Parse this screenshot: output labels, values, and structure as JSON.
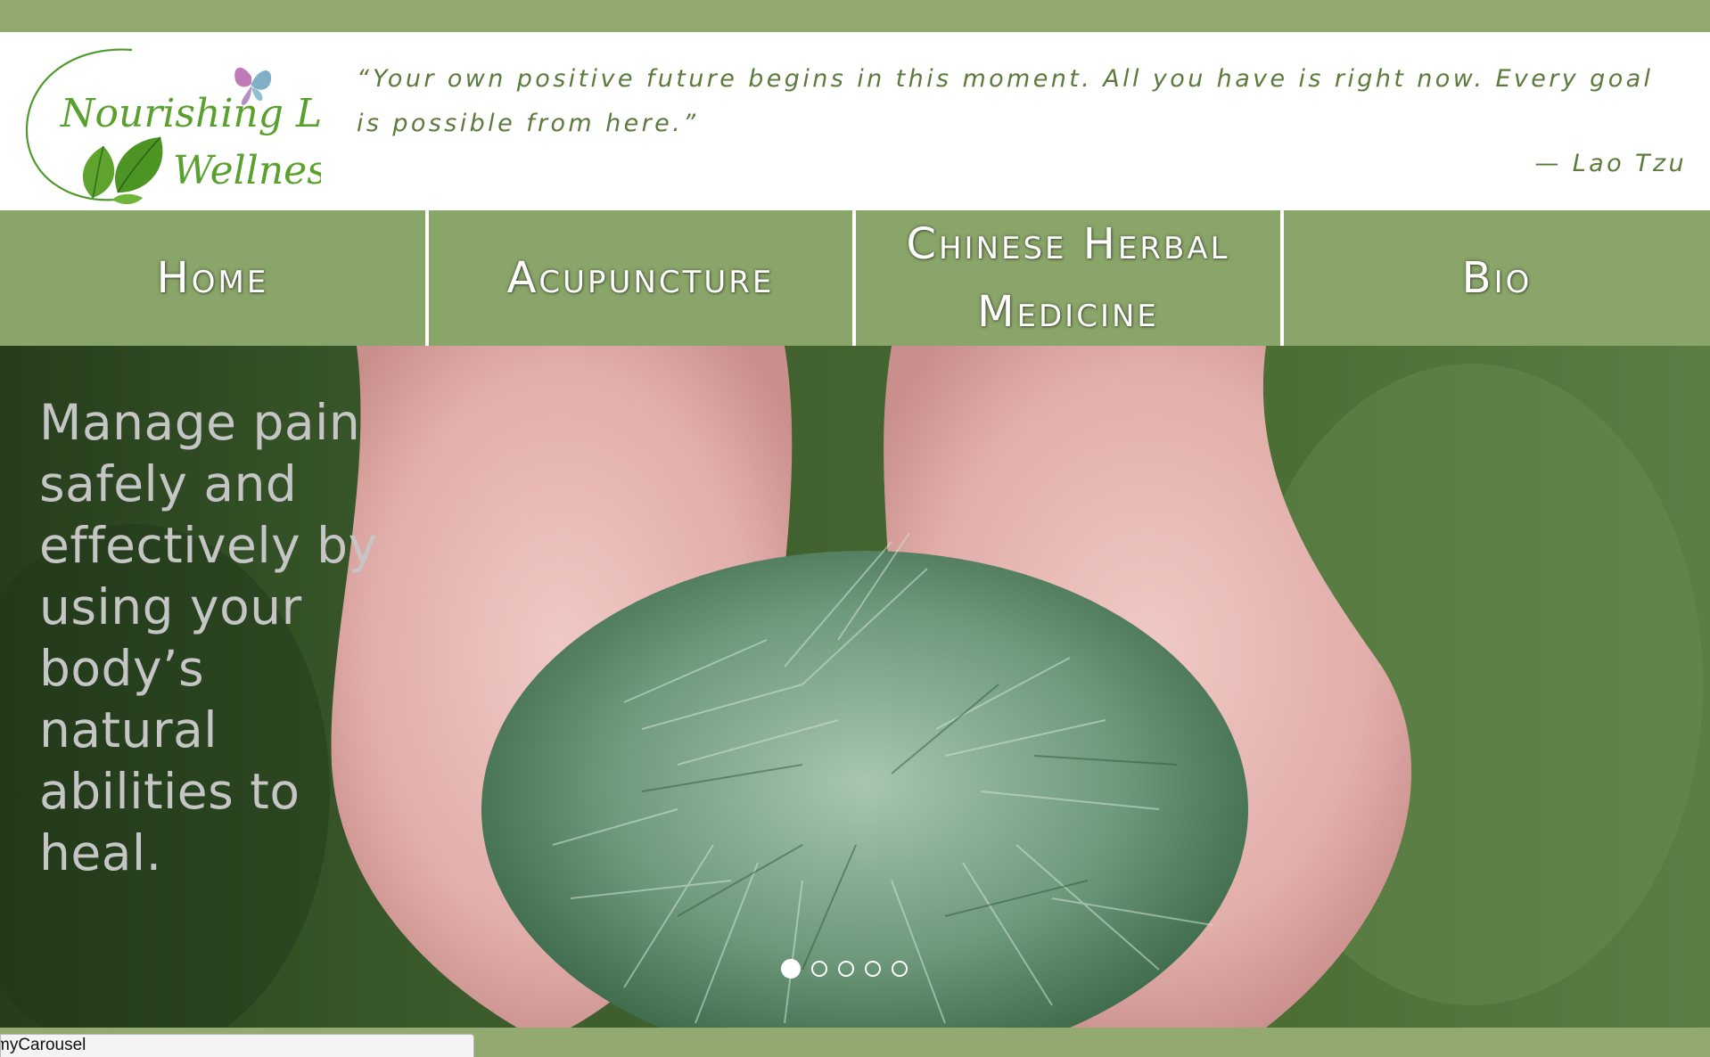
{
  "brand": {
    "line1": "Nourishing Life",
    "line2": "Wellness"
  },
  "quote": {
    "text": "“Your own positive future begins in this moment. All you have is right now. Every goal is possible from here.”",
    "author": "— Lao Tzu"
  },
  "nav": {
    "home": "Home",
    "acupuncture": "Acupuncture",
    "herbal_line1": "Chinese Herbal",
    "herbal_line2": "Medicine",
    "bio": "Bio"
  },
  "hero": {
    "caption": "Manage pain safely and effectively by using your body’s natural abilities to heal.",
    "slide_count": 5,
    "active_slide": 1
  },
  "status_bar": {
    "link_text": "myCarousel"
  },
  "colors": {
    "green_bar": "#92a970",
    "nav_green": "#8aa569",
    "quote_text": "#5c7a3c",
    "logo_green": "#5aa02f"
  }
}
